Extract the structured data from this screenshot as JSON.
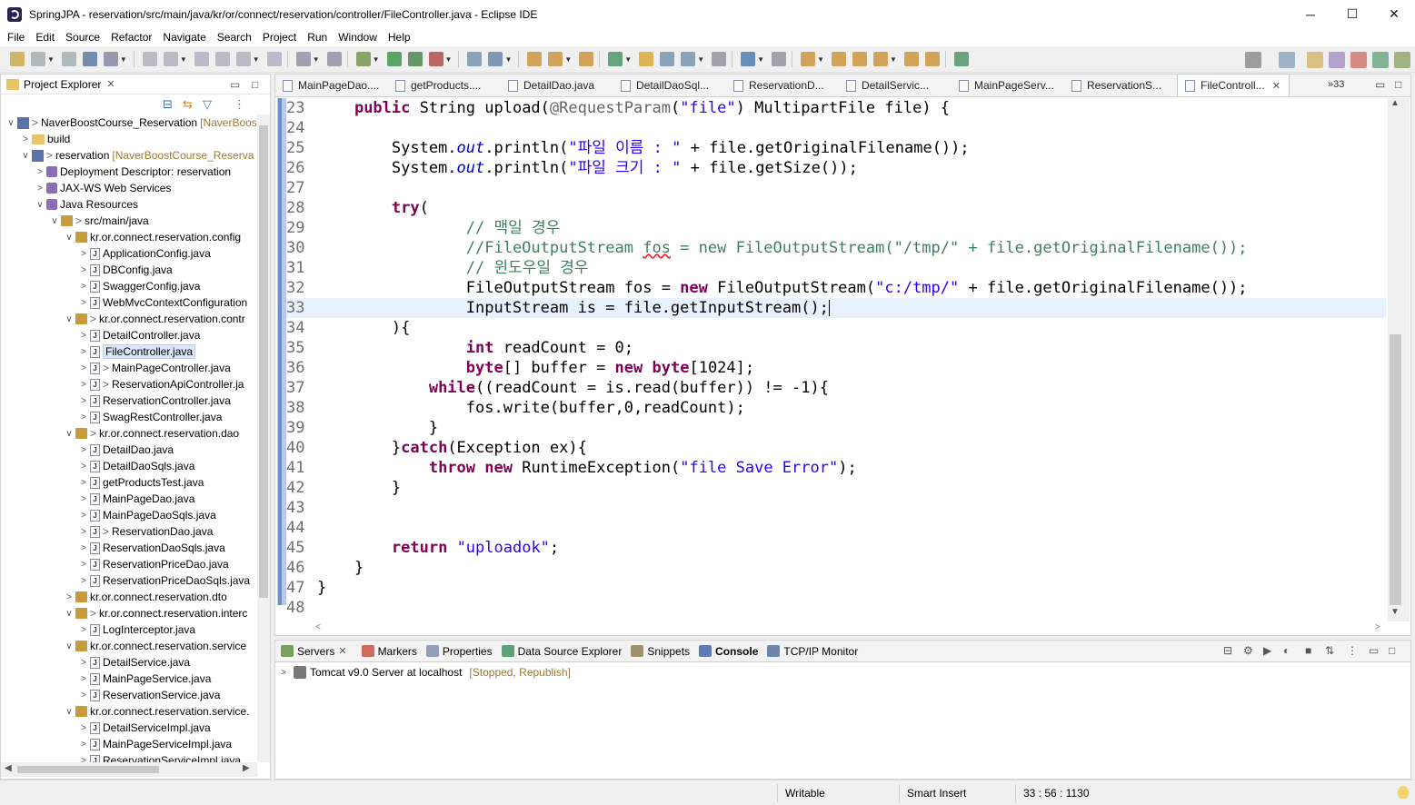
{
  "window": {
    "title": "SpringJPA - reservation/src/main/java/kr/or/connect/reservation/controller/FileController.java - Eclipse IDE",
    "minimize": "─",
    "maximize": "☐",
    "close": "✕"
  },
  "menu": [
    "File",
    "Edit",
    "Source",
    "Refactor",
    "Navigate",
    "Search",
    "Project",
    "Run",
    "Window",
    "Help"
  ],
  "explorer": {
    "title": "Project Explorer",
    "tree": [
      {
        "level": 0,
        "tw": "∨",
        "icon": "proj",
        "gt": ">",
        "text": "NaverBoostCourse_Reservation",
        "dim": "[NaverBoos"
      },
      {
        "level": 1,
        "tw": ">",
        "icon": "folder",
        "gt": "",
        "text": "build",
        "dim": ""
      },
      {
        "level": 1,
        "tw": "∨",
        "icon": "proj",
        "gt": ">",
        "text": "reservation",
        "dim": "[NaverBoostCourse_Reserva"
      },
      {
        "level": 2,
        "tw": ">",
        "icon": "lib",
        "gt": "",
        "text": "Deployment Descriptor: reservation",
        "dim": ""
      },
      {
        "level": 2,
        "tw": ">",
        "icon": "lib",
        "gt": "",
        "text": "JAX-WS Web Services",
        "dim": ""
      },
      {
        "level": 2,
        "tw": "∨",
        "icon": "lib",
        "gt": "",
        "text": "Java Resources",
        "dim": ""
      },
      {
        "level": 3,
        "tw": "∨",
        "icon": "pkg",
        "gt": ">",
        "text": "src/main/java",
        "dim": ""
      },
      {
        "level": 4,
        "tw": "∨",
        "icon": "pkg",
        "gt": "",
        "text": "kr.or.connect.reservation.config",
        "dim": ""
      },
      {
        "level": 5,
        "tw": ">",
        "icon": "java",
        "gt": "",
        "text": "ApplicationConfig.java",
        "dim": ""
      },
      {
        "level": 5,
        "tw": ">",
        "icon": "java",
        "gt": "",
        "text": "DBConfig.java",
        "dim": ""
      },
      {
        "level": 5,
        "tw": ">",
        "icon": "java",
        "gt": "",
        "text": "SwaggerConfig.java",
        "dim": ""
      },
      {
        "level": 5,
        "tw": ">",
        "icon": "java",
        "gt": "",
        "text": "WebMvcContextConfiguration",
        "dim": ""
      },
      {
        "level": 4,
        "tw": "∨",
        "icon": "pkg",
        "gt": ">",
        "text": "kr.or.connect.reservation.contr",
        "dim": ""
      },
      {
        "level": 5,
        "tw": ">",
        "icon": "java",
        "gt": "",
        "text": "DetailController.java",
        "dim": ""
      },
      {
        "level": 5,
        "tw": ">",
        "icon": "java",
        "gt": "",
        "text": "FileController.java",
        "dim": "",
        "selected": true
      },
      {
        "level": 5,
        "tw": ">",
        "icon": "java",
        "gt": ">",
        "text": "MainPageController.java",
        "dim": ""
      },
      {
        "level": 5,
        "tw": ">",
        "icon": "java",
        "gt": ">",
        "text": "ReservationApiController.ja",
        "dim": ""
      },
      {
        "level": 5,
        "tw": ">",
        "icon": "java",
        "gt": "",
        "text": "ReservationController.java",
        "dim": ""
      },
      {
        "level": 5,
        "tw": ">",
        "icon": "java",
        "gt": "",
        "text": "SwagRestController.java",
        "dim": ""
      },
      {
        "level": 4,
        "tw": "∨",
        "icon": "pkg",
        "gt": ">",
        "text": "kr.or.connect.reservation.dao",
        "dim": ""
      },
      {
        "level": 5,
        "tw": ">",
        "icon": "java",
        "gt": "",
        "text": "DetailDao.java",
        "dim": ""
      },
      {
        "level": 5,
        "tw": ">",
        "icon": "java",
        "gt": "",
        "text": "DetailDaoSqls.java",
        "dim": ""
      },
      {
        "level": 5,
        "tw": ">",
        "icon": "java",
        "gt": "",
        "text": "getProductsTest.java",
        "dim": ""
      },
      {
        "level": 5,
        "tw": ">",
        "icon": "java",
        "gt": "",
        "text": "MainPageDao.java",
        "dim": ""
      },
      {
        "level": 5,
        "tw": ">",
        "icon": "java",
        "gt": "",
        "text": "MainPageDaoSqls.java",
        "dim": ""
      },
      {
        "level": 5,
        "tw": ">",
        "icon": "java",
        "gt": ">",
        "text": "ReservationDao.java",
        "dim": ""
      },
      {
        "level": 5,
        "tw": ">",
        "icon": "java",
        "gt": "",
        "text": "ReservationDaoSqls.java",
        "dim": ""
      },
      {
        "level": 5,
        "tw": ">",
        "icon": "java",
        "gt": "",
        "text": "ReservationPriceDao.java",
        "dim": ""
      },
      {
        "level": 5,
        "tw": ">",
        "icon": "java",
        "gt": "",
        "text": "ReservationPriceDaoSqls.java",
        "dim": ""
      },
      {
        "level": 4,
        "tw": ">",
        "icon": "pkg",
        "gt": "",
        "text": "kr.or.connect.reservation.dto",
        "dim": ""
      },
      {
        "level": 4,
        "tw": "∨",
        "icon": "pkg",
        "gt": ">",
        "text": "kr.or.connect.reservation.interc",
        "dim": ""
      },
      {
        "level": 5,
        "tw": ">",
        "icon": "java",
        "gt": "",
        "text": "LogInterceptor.java",
        "dim": ""
      },
      {
        "level": 4,
        "tw": "∨",
        "icon": "pkg",
        "gt": "",
        "text": "kr.or.connect.reservation.service",
        "dim": ""
      },
      {
        "level": 5,
        "tw": ">",
        "icon": "java",
        "gt": "",
        "text": "DetailService.java",
        "dim": ""
      },
      {
        "level": 5,
        "tw": ">",
        "icon": "java",
        "gt": "",
        "text": "MainPageService.java",
        "dim": ""
      },
      {
        "level": 5,
        "tw": ">",
        "icon": "java",
        "gt": "",
        "text": "ReservationService.java",
        "dim": ""
      },
      {
        "level": 4,
        "tw": "∨",
        "icon": "pkg",
        "gt": "",
        "text": "kr.or.connect.reservation.service.",
        "dim": ""
      },
      {
        "level": 5,
        "tw": ">",
        "icon": "java",
        "gt": "",
        "text": "DetailServiceImpl.java",
        "dim": ""
      },
      {
        "level": 5,
        "tw": ">",
        "icon": "java",
        "gt": "",
        "text": "MainPageServiceImpl.java",
        "dim": ""
      },
      {
        "level": 5,
        "tw": ">",
        "icon": "java",
        "gt": "",
        "text": "ReservationServiceImpl.java",
        "dim": ""
      }
    ]
  },
  "editor": {
    "tabs": [
      {
        "label": "MainPageDao....",
        "active": false
      },
      {
        "label": "getProducts....",
        "active": false
      },
      {
        "label": "DetailDao.java",
        "active": false
      },
      {
        "label": "DetailDaoSql...",
        "active": false
      },
      {
        "label": "ReservationD...",
        "active": false
      },
      {
        "label": "DetailServic...",
        "active": false
      },
      {
        "label": "MainPageServ...",
        "active": false
      },
      {
        "label": "ReservationS...",
        "active": false
      },
      {
        "label": "FileControll...",
        "active": true
      }
    ],
    "more_tabs": "»33",
    "current_line": 33,
    "lines": [
      {
        "n": "23",
        "seg": [
          [
            "",
            "    "
          ],
          [
            "kw",
            "public"
          ],
          [
            "",
            " String upload("
          ],
          [
            "ann",
            "@RequestParam"
          ],
          [
            "",
            "("
          ],
          [
            "str",
            "\"file\""
          ],
          [
            "",
            ") MultipartFile file) {"
          ]
        ]
      },
      {
        "n": "24",
        "seg": []
      },
      {
        "n": "25",
        "seg": [
          [
            "",
            "        System."
          ],
          [
            "fld",
            "out"
          ],
          [
            "",
            ".println("
          ],
          [
            "str",
            "\"파일 이름 : \""
          ],
          [
            "",
            " + file.getOriginalFilename());"
          ]
        ]
      },
      {
        "n": "26",
        "seg": [
          [
            "",
            "        System."
          ],
          [
            "fld",
            "out"
          ],
          [
            "",
            ".println("
          ],
          [
            "str",
            "\"파일 크기 : \""
          ],
          [
            "",
            " + file.getSize());"
          ]
        ]
      },
      {
        "n": "27",
        "seg": []
      },
      {
        "n": "28",
        "seg": [
          [
            "",
            "        "
          ],
          [
            "kw",
            "try"
          ],
          [
            "",
            "("
          ]
        ]
      },
      {
        "n": "29",
        "seg": [
          [
            "",
            "                "
          ],
          [
            "cm",
            "// 맥일 경우"
          ]
        ]
      },
      {
        "n": "30",
        "seg": [
          [
            "",
            "                "
          ],
          [
            "cm",
            "//FileOutputStream "
          ],
          [
            "cm err",
            "fos"
          ],
          [
            "cm",
            " = new FileOutputStream(\"/tmp/\" + file.getOriginalFilename());"
          ]
        ]
      },
      {
        "n": "31",
        "seg": [
          [
            "",
            "                "
          ],
          [
            "cm",
            "// 윈도우일 경우"
          ]
        ]
      },
      {
        "n": "32",
        "seg": [
          [
            "",
            "                FileOutputStream fos = "
          ],
          [
            "kw",
            "new"
          ],
          [
            "",
            " FileOutputStream("
          ],
          [
            "str",
            "\"c:/tmp/\""
          ],
          [
            "",
            " + file.getOriginalFilename());"
          ]
        ]
      },
      {
        "n": "33",
        "seg": [
          [
            "",
            "                InputStream is = file.getInputStream();"
          ]
        ]
      },
      {
        "n": "34",
        "seg": [
          [
            "",
            "        ){"
          ]
        ]
      },
      {
        "n": "35",
        "seg": [
          [
            "",
            "                "
          ],
          [
            "kw",
            "int"
          ],
          [
            "",
            " readCount = 0;"
          ]
        ]
      },
      {
        "n": "36",
        "seg": [
          [
            "",
            "                "
          ],
          [
            "kw",
            "byte"
          ],
          [
            "",
            "[] buffer = "
          ],
          [
            "kw",
            "new"
          ],
          [
            "",
            " "
          ],
          [
            "kw",
            "byte"
          ],
          [
            "",
            "[1024];"
          ]
        ]
      },
      {
        "n": "37",
        "seg": [
          [
            "",
            "            "
          ],
          [
            "kw",
            "while"
          ],
          [
            "",
            "((readCount = is.read(buffer)) != -1){"
          ]
        ]
      },
      {
        "n": "38",
        "seg": [
          [
            "",
            "                fos.write(buffer,0,readCount);"
          ]
        ]
      },
      {
        "n": "39",
        "seg": [
          [
            "",
            "            }"
          ]
        ]
      },
      {
        "n": "40",
        "seg": [
          [
            "",
            "        }"
          ],
          [
            "kw",
            "catch"
          ],
          [
            "",
            "(Exception ex){"
          ]
        ]
      },
      {
        "n": "41",
        "seg": [
          [
            "",
            "            "
          ],
          [
            "kw",
            "throw"
          ],
          [
            "",
            " "
          ],
          [
            "kw",
            "new"
          ],
          [
            "",
            " RuntimeException("
          ],
          [
            "str",
            "\"file Save Error\""
          ],
          [
            "",
            ");"
          ]
        ]
      },
      {
        "n": "42",
        "seg": [
          [
            "",
            "        }"
          ]
        ]
      },
      {
        "n": "43",
        "seg": []
      },
      {
        "n": "44",
        "seg": []
      },
      {
        "n": "45",
        "seg": [
          [
            "",
            "        "
          ],
          [
            "kw",
            "return"
          ],
          [
            "",
            " "
          ],
          [
            "str",
            "\"uploadok\""
          ],
          [
            "",
            ";"
          ]
        ]
      },
      {
        "n": "46",
        "seg": [
          [
            "",
            "    }"
          ]
        ]
      },
      {
        "n": "47",
        "seg": [
          [
            "",
            "}"
          ]
        ]
      },
      {
        "n": "48",
        "seg": []
      }
    ]
  },
  "bottom": {
    "tabs": [
      {
        "label": "Servers",
        "icon": "#5a8a3a",
        "closable": true,
        "active": false
      },
      {
        "label": "Markers",
        "icon": "#c04a3a",
        "closable": false,
        "active": false
      },
      {
        "label": "Properties",
        "icon": "#7a8aa8",
        "closable": false,
        "active": false
      },
      {
        "label": "Data Source Explorer",
        "icon": "#3a8a5a",
        "closable": false,
        "active": false
      },
      {
        "label": "Snippets",
        "icon": "#8a7a4a",
        "closable": false,
        "active": false
      },
      {
        "label": "Console",
        "icon": "#3a5aa8",
        "closable": false,
        "active": true
      },
      {
        "label": "TCP/IP Monitor",
        "icon": "#4a6a9a",
        "closable": false,
        "active": false
      }
    ],
    "server": {
      "name": "Tomcat v9.0 Server at localhost",
      "state": "[Stopped, Republish]"
    }
  },
  "status": {
    "writable": "Writable",
    "insert_mode": "Smart Insert",
    "position": "33 : 56 : 1130"
  },
  "colors": {
    "keyword": "#7f0055",
    "string": "#2a00ff",
    "comment": "#3f7f5f",
    "field": "#0000c0",
    "current_line": "#e8f2fe"
  }
}
